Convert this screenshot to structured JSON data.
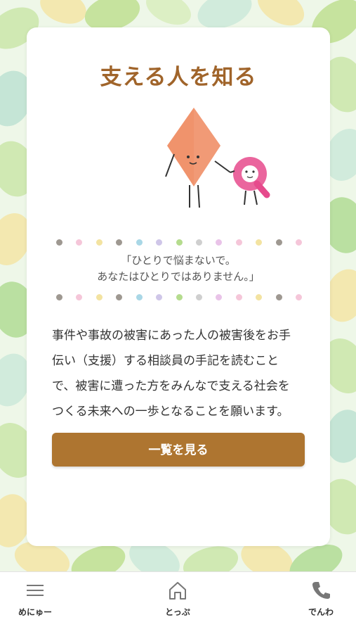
{
  "main": {
    "title": "支える人を知る",
    "quote_line1": "「ひとりで悩まないで。",
    "quote_line2": "あなたはひとりではありません。」",
    "body_lines": [
      "事件や事故の被害にあった人の被害後をお手",
      "伝い（支援）する相談員の手記を読むこと",
      "で、被害に遭った方をみんなで支える社会を",
      "つくる未来への一歩となることを願います。"
    ],
    "button_label": "一覧を見る"
  },
  "dot_colors": [
    "#9e9891",
    "#f5c6d9",
    "#f3e3a1",
    "#9e9891",
    "#a9d7e6",
    "#cfc6e8",
    "#b5dc8e",
    "#cfcfcf",
    "#e9c3e8",
    "#f5c6d9",
    "#f3e3a1",
    "#9e9891",
    "#f5c6d9"
  ],
  "colors": {
    "accent": "#ae7530",
    "title": "#a0642a"
  },
  "tabbar": {
    "items": [
      {
        "label": "めにゅー",
        "icon": "hamburger-menu-icon"
      },
      {
        "label": "とっぷ",
        "icon": "home-icon"
      },
      {
        "label": "でんわ",
        "icon": "phone-icon"
      }
    ]
  }
}
